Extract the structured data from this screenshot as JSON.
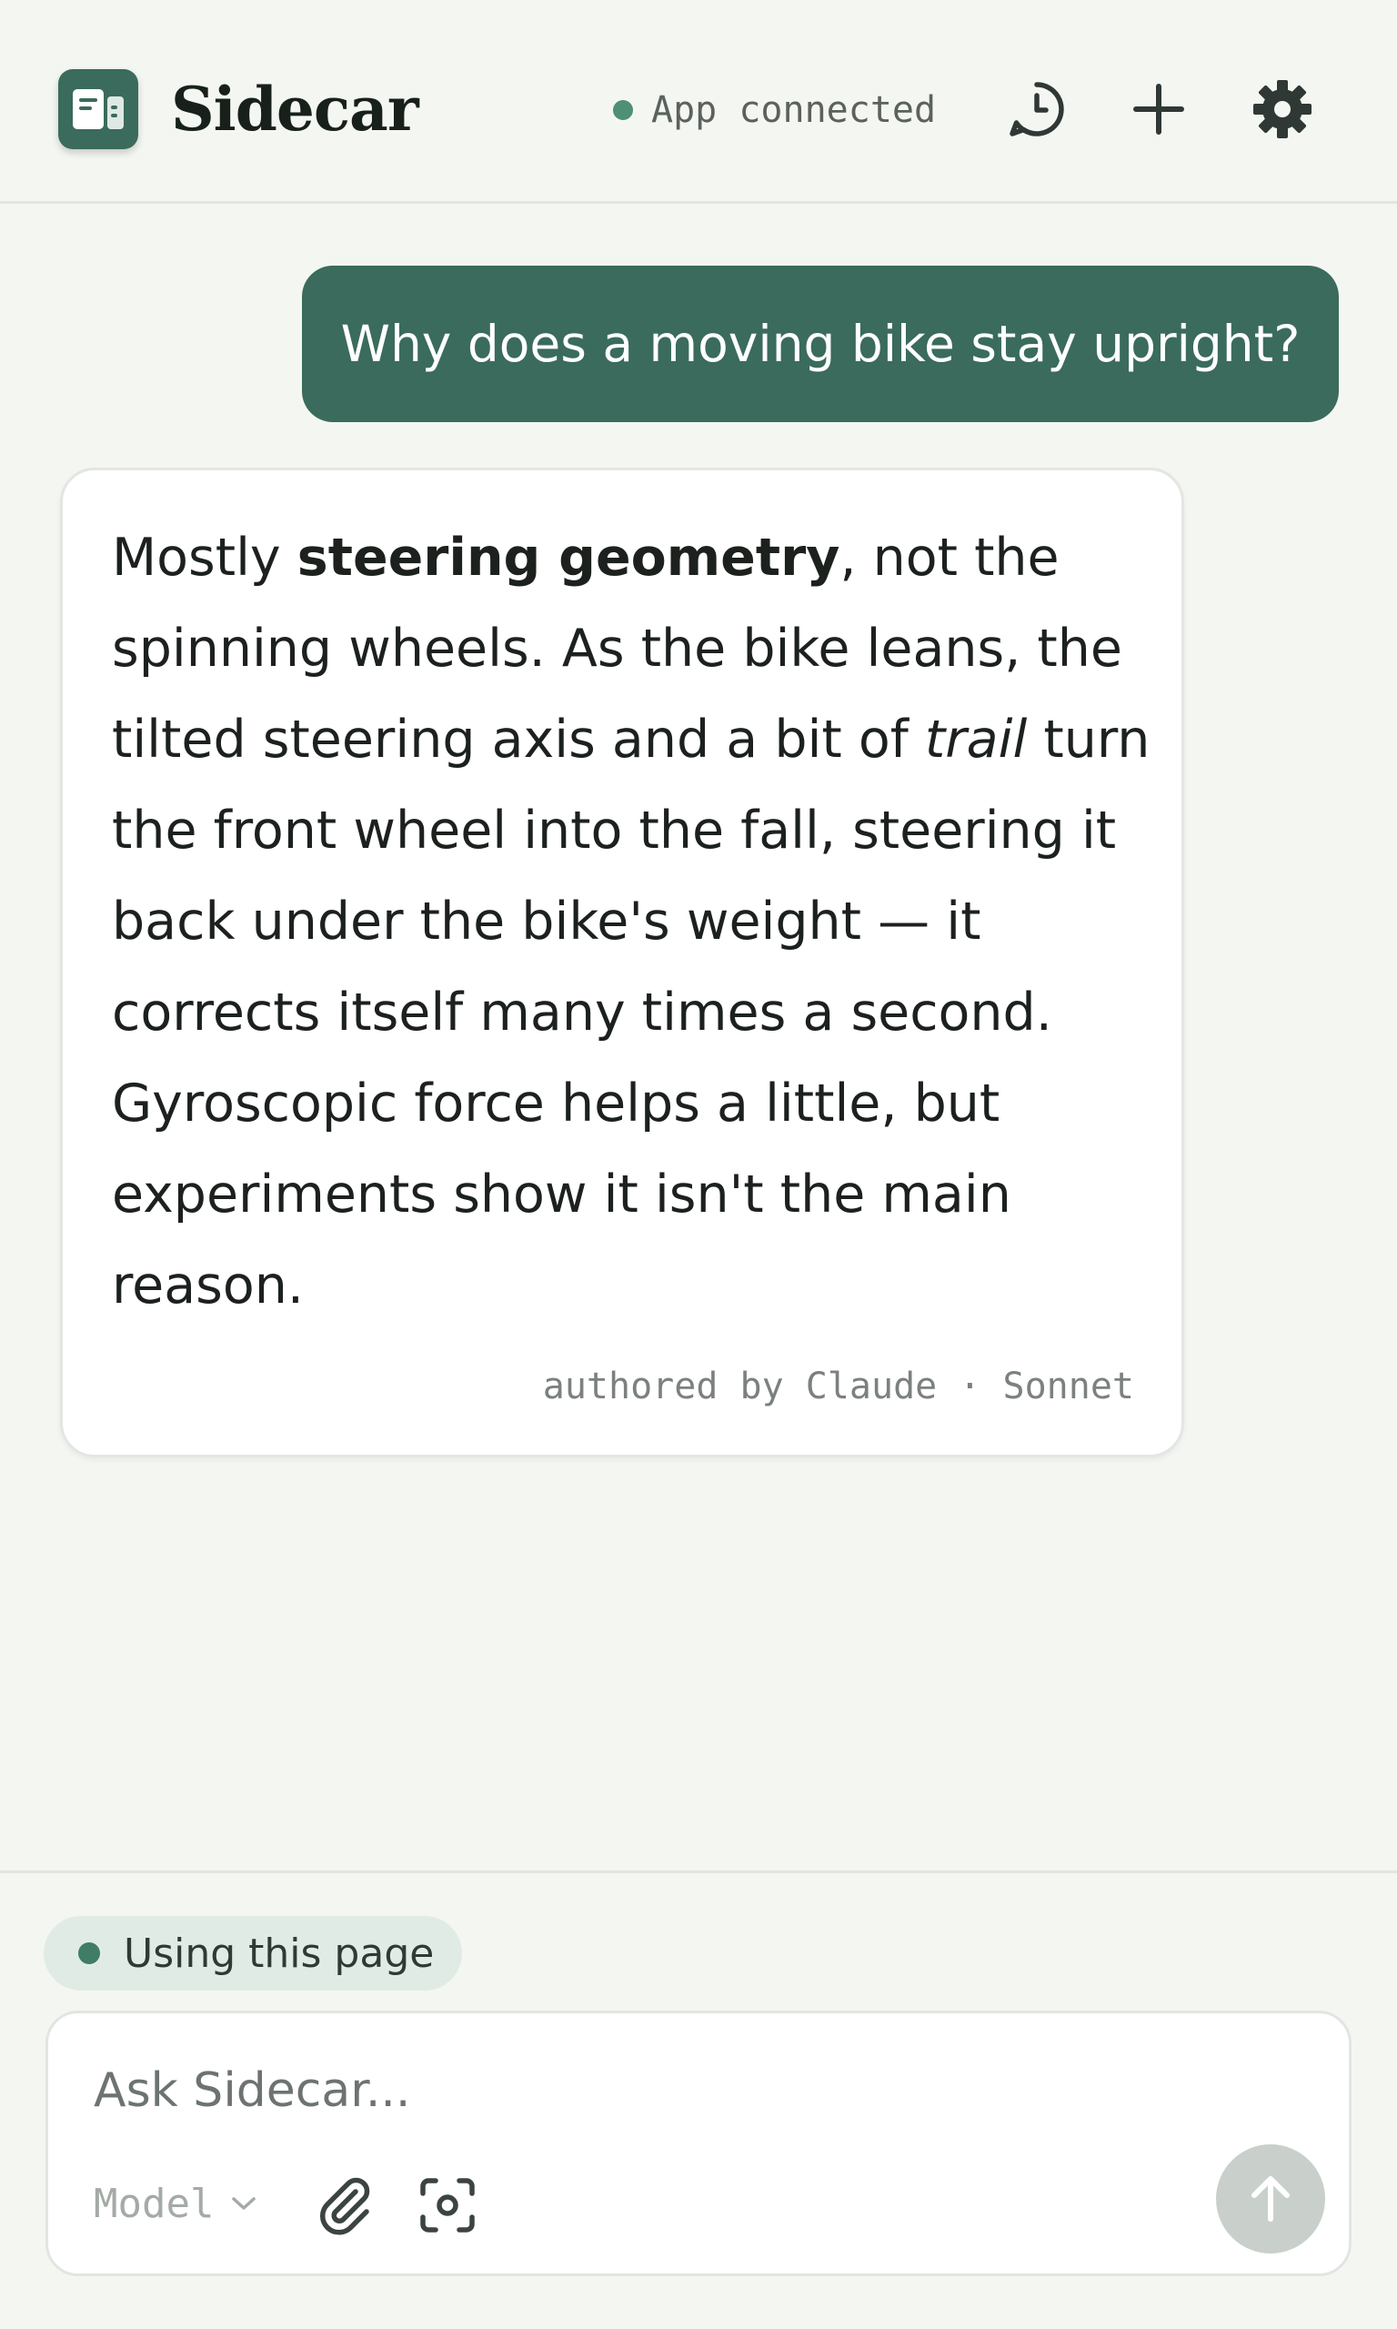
{
  "header": {
    "app_name": "Sidecar",
    "status_text": "App connected",
    "status_color": "#4f8f73",
    "icons": [
      "app-logo-icon",
      "history-icon",
      "plus-icon",
      "gear-icon"
    ]
  },
  "conversation": {
    "user_message": "Why does a moving bike stay upright?",
    "assistant_message": {
      "lead": "Mostly ",
      "bold": "steering geometry",
      "after_bold": ", not the spinning wheels. As the bike leans, the tilted steering axis and a bit of ",
      "italic": "trail",
      "rest": " turn the front wheel into the fall, steering it back under the bike's weight — it corrects itself many times a second. Gyroscopic force helps a little, but experiments show it isn't the main reason."
    },
    "attribution": {
      "prefix": "authored by ",
      "author": "Claude",
      "separator": " · ",
      "model": "Sonnet"
    }
  },
  "composer": {
    "context_chip": "Using this page",
    "placeholder": "Ask Sidecar...",
    "model_label": "Model",
    "accent_color": "#3a6b5c"
  }
}
